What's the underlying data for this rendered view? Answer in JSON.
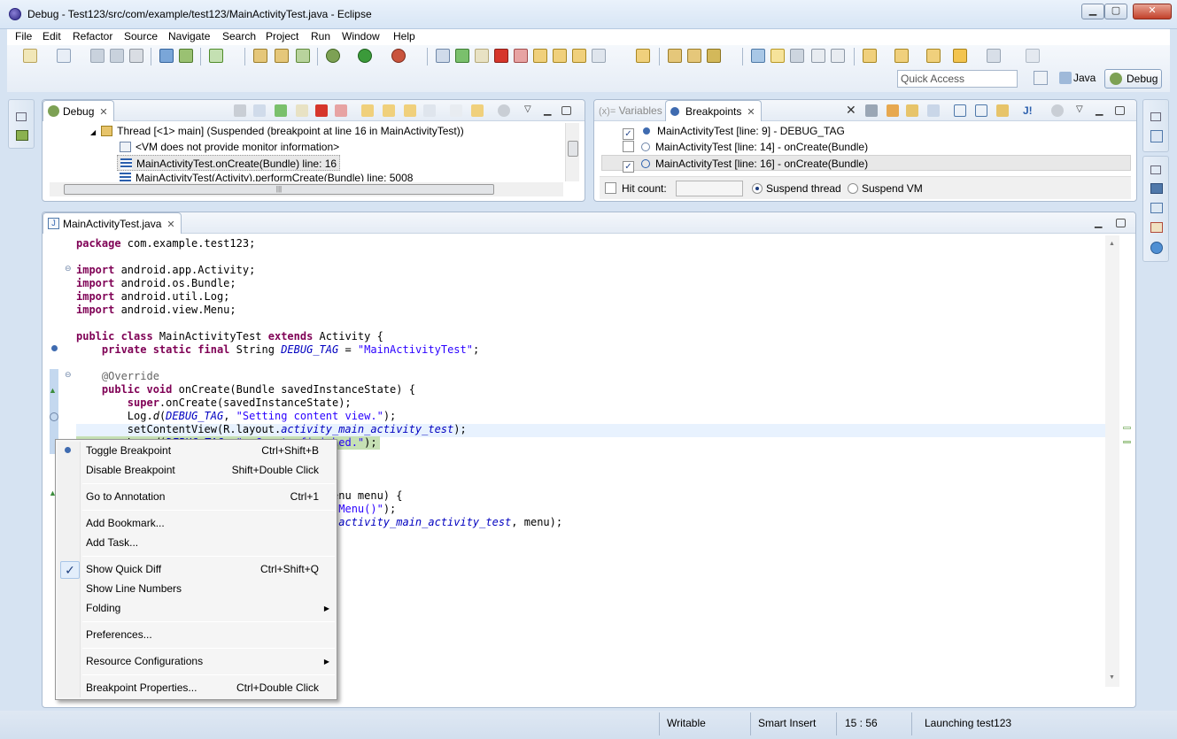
{
  "window": {
    "title": "Debug - Test123/src/com/example/test123/MainActivityTest.java - Eclipse",
    "min": "▁",
    "max": "▢",
    "close": "✕"
  },
  "menubar": [
    "File",
    "Edit",
    "Refactor",
    "Source",
    "Navigate",
    "Search",
    "Project",
    "Run",
    "Window",
    "Help"
  ],
  "toolbar": {
    "quick_access_placeholder": "Quick Access",
    "perspectives": {
      "java": "Java",
      "debug": "Debug"
    }
  },
  "colors": {
    "accent": "#2b5fad",
    "keyword": "#7f0055",
    "string": "#2a00ff",
    "field": "#0000c0",
    "annotation": "#646464",
    "current_line": "#e8f2fe",
    "debug_highlight": "#c6e0b4"
  },
  "debug_view": {
    "tab": "Debug",
    "rows": [
      {
        "text": "Thread [<1> main] (Suspended (breakpoint at line 16 in MainActivityTest))",
        "icon": "thread-icon"
      },
      {
        "text": "<VM does not provide monitor information>",
        "icon": "info-icon"
      },
      {
        "text": "MainActivityTest.onCreate(Bundle) line: 16",
        "icon": "stack-frame-icon"
      },
      {
        "text": "MainActivityTest(Activity).performCreate(Bundle) line: 5008",
        "icon": "stack-frame-icon"
      }
    ]
  },
  "variables_tab": "Variables",
  "breakpoints_view": {
    "tab": "Breakpoints",
    "items": [
      {
        "label": "MainActivityTest [line: 9] - DEBUG_TAG",
        "checked": true
      },
      {
        "label": "MainActivityTest [line: 14] - onCreate(Bundle)",
        "checked": false
      },
      {
        "label": "MainActivityTest [line: 16] - onCreate(Bundle)",
        "checked": true
      }
    ],
    "hit_count_label": "Hit count:",
    "suspend_thread": "Suspend thread",
    "suspend_vm": "Suspend VM"
  },
  "editor": {
    "tab": "MainActivityTest.java"
  },
  "context_menu": [
    {
      "label": "Toggle Breakpoint",
      "shortcut": "Ctrl+Shift+B"
    },
    {
      "label": "Disable Breakpoint",
      "shortcut": "Shift+Double Click"
    },
    {
      "label": "Go to Annotation",
      "shortcut": "Ctrl+1"
    },
    {
      "label": "Add Bookmark...",
      "shortcut": ""
    },
    {
      "label": "Add Task...",
      "shortcut": ""
    },
    {
      "label": "Show Quick Diff",
      "shortcut": "Ctrl+Shift+Q"
    },
    {
      "label": "Show Line Numbers",
      "shortcut": ""
    },
    {
      "label": "Folding",
      "shortcut": ""
    },
    {
      "label": "Preferences...",
      "shortcut": ""
    },
    {
      "label": "Resource Configurations",
      "shortcut": ""
    },
    {
      "label": "Breakpoint Properties...",
      "shortcut": "Ctrl+Double Click"
    }
  ],
  "statusbar": {
    "writable": "Writable",
    "insert_mode": "Smart Insert",
    "position": "15 : 56",
    "progress": "Launching test123"
  }
}
